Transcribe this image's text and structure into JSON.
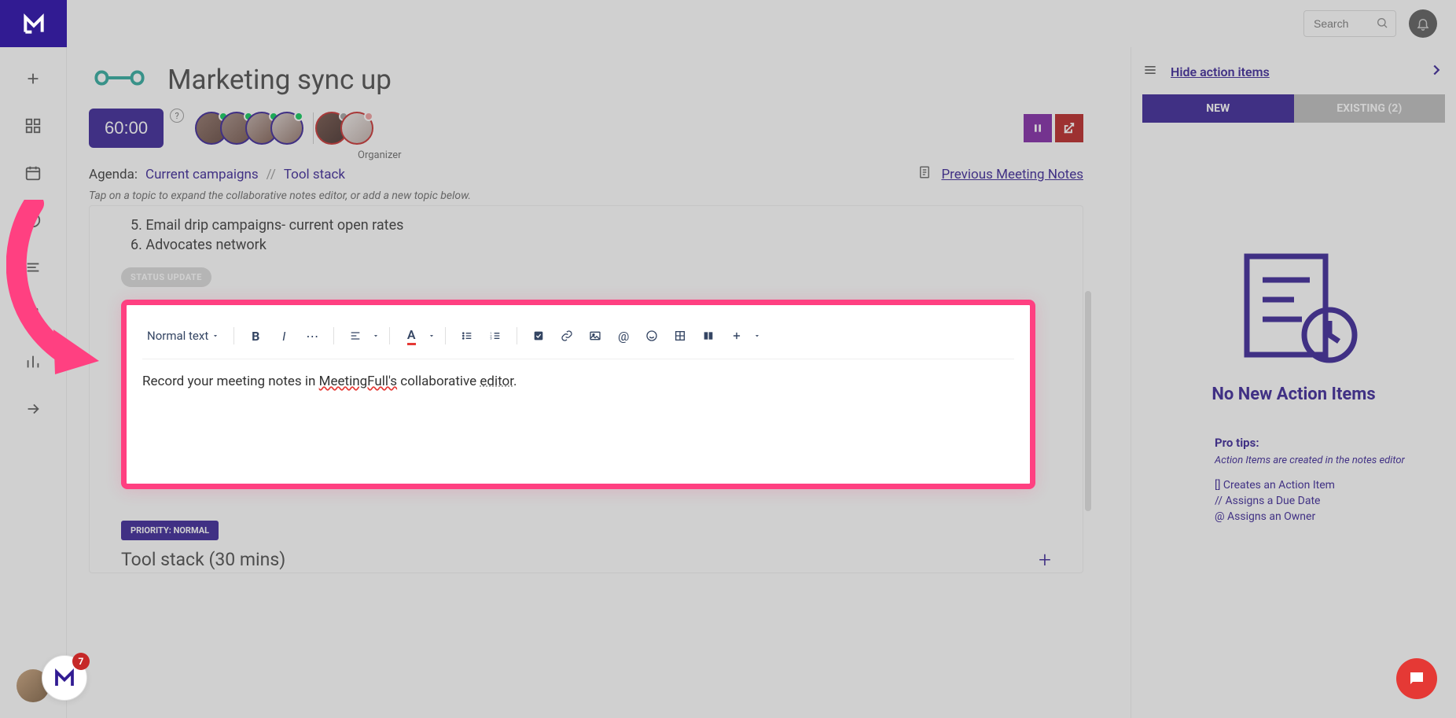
{
  "app": {
    "search_placeholder": "Search"
  },
  "page": {
    "title": "Marketing sync up",
    "timer": "60:00",
    "organizer_label": "Organizer",
    "agenda_label": "Agenda:",
    "agenda_items": [
      "Current campaigns",
      "Tool stack"
    ],
    "previous_notes": "Previous Meeting Notes",
    "hint": "Tap on a topic to expand the collaborative notes editor, or add a new topic below.",
    "list": [
      "5. Email drip campaigns- current open rates",
      "6. Advocates network"
    ],
    "status_badge": "STATUS UPDATE",
    "editor_text_dropdown": "Normal text",
    "editor_placeholder_pre": "Record your meeting notes in ",
    "editor_placeholder_mid": "MeetingFull's",
    "editor_placeholder_post": " collaborative ",
    "editor_placeholder_end": "editor",
    "priority_badge": "PRIORITY: NORMAL",
    "next_topic": "Tool stack (30 mins)"
  },
  "participants": {
    "team": [
      {
        "status": "online"
      },
      {
        "status": "online"
      },
      {
        "status": "online"
      },
      {
        "status": "online"
      }
    ],
    "external": [
      {
        "status": "offline"
      },
      {
        "status": "away"
      }
    ]
  },
  "right_panel": {
    "hide_label": "Hide action items",
    "tab_new": "NEW",
    "tab_existing": "EXISTING (2)",
    "empty_heading": "No New Action Items",
    "pro_tips_label": "Pro tips:",
    "pro_tips_sub": "Action Items are created in the notes editor",
    "tips": [
      "[] Creates an Action Item",
      "// Assigns a Due Date",
      "@ Assigns an Owner"
    ]
  },
  "fab_badge": "7",
  "colors": {
    "primary": "#311b92",
    "highlight": "#ff4081",
    "danger": "#c62828"
  }
}
